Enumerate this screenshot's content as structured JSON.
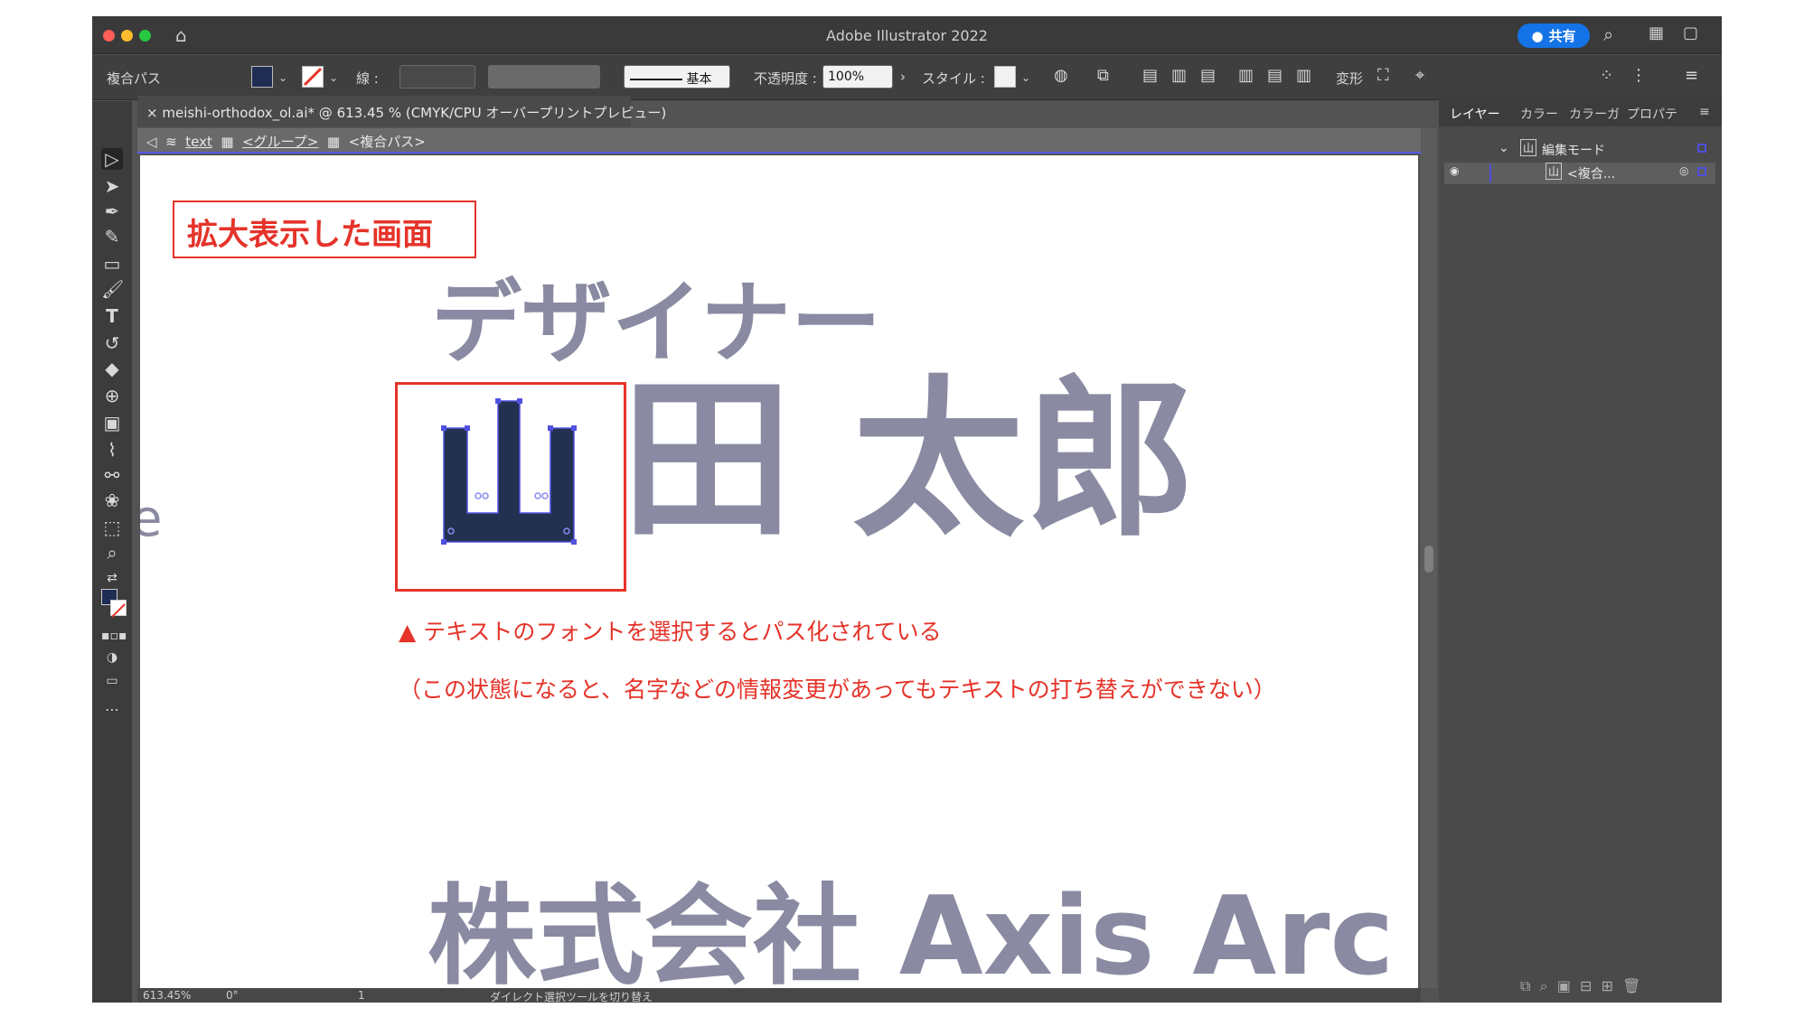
{
  "window": {
    "title": "Adobe Illustrator 2022",
    "share_label": "共有",
    "icons": [
      "home-icon",
      "share-user-icon",
      "search-icon",
      "workspace-icon",
      "window-icon"
    ]
  },
  "controlbar": {
    "selection_type": "複合パス",
    "stroke_label": "線 :",
    "stroke_style": "基本",
    "opacity_label": "不透明度 :",
    "opacity_value": "100%",
    "style_label": "スタイル :",
    "transform_label": "変形",
    "fill_color": "#1f2d55"
  },
  "document": {
    "tab_title": "meishi-orthodox_ol.ai* @ 613.45 % (CMYK/CPU オーバープリントプレビュー)",
    "breadcrumb": [
      "text",
      "<グループ>",
      "<複合パス>"
    ]
  },
  "canvas": {
    "annotation_title": "拡大表示した画面",
    "job_title": "デザイナー",
    "name_selected_char": "山",
    "name_rest": "田 太郎",
    "company": "株式会社 Axis Arc",
    "left_partial": "e",
    "note_line1": "▲ テキストのフォントを選択するとパス化されている",
    "note_line2": "（この状態になると、名字などの情報変更があってもテキストの打ち替えができない）",
    "text_color": "#8a8aa2",
    "accent_red": "#e5332a",
    "path_fill": "#22314f"
  },
  "statusbar": {
    "zoom": "613.45%",
    "rotation": "0°",
    "artboard": "1",
    "tool_hint": "ダイレクト選択ツールを切り替え"
  },
  "panel": {
    "tabs": [
      "レイヤー",
      "カラー",
      "カラーガ",
      "プロパテ"
    ],
    "layers": [
      {
        "label": "編集モード"
      },
      {
        "label": "<複合..."
      }
    ]
  }
}
